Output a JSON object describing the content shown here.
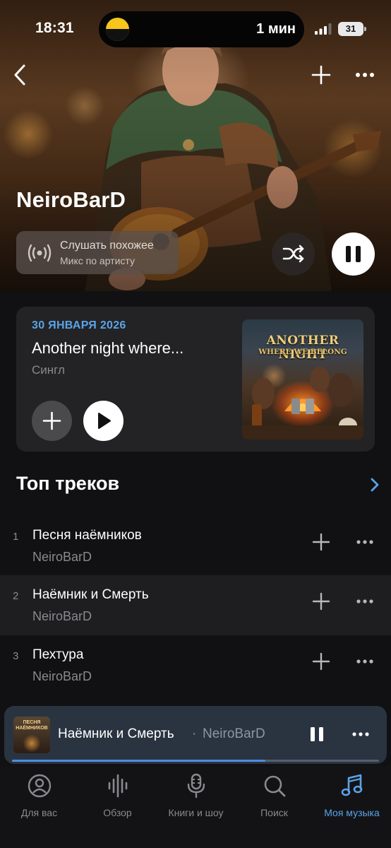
{
  "status_bar": {
    "time": "18:31",
    "live_activity_text": "1 мин",
    "battery_level": "31"
  },
  "header": {
    "back_icon": "chevron-left-icon",
    "add_icon": "plus-icon",
    "more_icon": "ellipsis-icon"
  },
  "artist": {
    "name": "NeiroBarD",
    "similar": {
      "title": "Слушать похожее",
      "subtitle": "Микс по артисту",
      "icon": "broadcast-icon"
    },
    "shuffle_icon": "shuffle-icon",
    "playback_icon": "pause-icon"
  },
  "release": {
    "date": "30 ЯНВАРЯ 2026",
    "title": "Another night where...",
    "type": "Сингл",
    "cover_title": "ANOTHER NIGHT",
    "cover_subtitle": "WHERE WE BELONG"
  },
  "top_tracks": {
    "title": "Топ треков",
    "tracks": [
      {
        "number": "1",
        "title": "Песня наёмников",
        "artist": "NeiroBarD"
      },
      {
        "number": "2",
        "title": "Наёмник и Смерть",
        "artist": "NeiroBarD"
      },
      {
        "number": "3",
        "title": "Пехтура",
        "artist": "NeiroBarD"
      }
    ]
  },
  "now_playing": {
    "cover_text": "ПЕСНЯ НАЁМНИКОВ",
    "title": "Наёмник и Смерть",
    "separator": "·",
    "artist": "NeiroBarD",
    "progress": 0.69
  },
  "tabbar": {
    "tabs": [
      {
        "label": "Для вас",
        "icon": "person-icon"
      },
      {
        "label": "Обзор",
        "icon": "equalizer-icon"
      },
      {
        "label": "Книги и шоу",
        "icon": "microphone-icon"
      },
      {
        "label": "Поиск",
        "icon": "search-icon"
      },
      {
        "label": "Моя музыка",
        "icon": "music-note-icon"
      }
    ],
    "active_index": 4
  },
  "colors": {
    "accent": "#5aa3e8",
    "background": "#111113",
    "card": "#232325",
    "mini_player": "#2a3441"
  }
}
